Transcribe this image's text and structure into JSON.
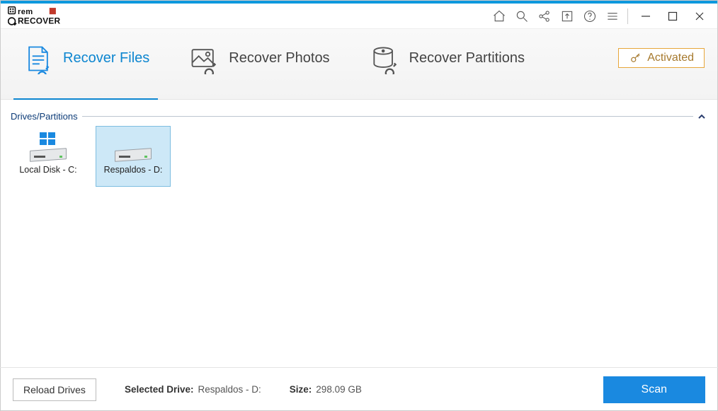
{
  "app": {
    "logo_top": "remo",
    "logo_bottom": "RECOVER"
  },
  "titlebar": {
    "icons": [
      "home-icon",
      "search-icon",
      "share-icon",
      "export-icon",
      "help-icon",
      "menu-icon"
    ]
  },
  "toolbar": {
    "tabs": [
      {
        "label": "Recover Files",
        "icon": "files-icon",
        "active": true
      },
      {
        "label": "Recover Photos",
        "icon": "photos-icon",
        "active": false
      },
      {
        "label": "Recover Partitions",
        "icon": "partitions-icon",
        "active": false
      }
    ],
    "activated_label": "Activated"
  },
  "section": {
    "title": "Drives/Partitions"
  },
  "drives": [
    {
      "label": "Local Disk - C:",
      "os": "windows",
      "selected": false
    },
    {
      "label": "Respaldos - D:",
      "os": "none",
      "selected": true
    }
  ],
  "footer": {
    "reload_label": "Reload Drives",
    "selected_key": "Selected Drive:",
    "selected_value": "Respaldos - D:",
    "size_key": "Size:",
    "size_value": "298.09 GB",
    "scan_label": "Scan"
  }
}
